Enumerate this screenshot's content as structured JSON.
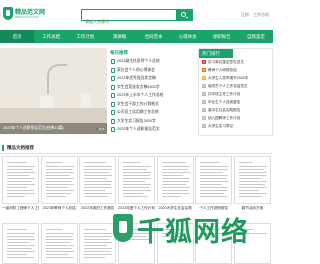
{
  "header": {
    "logo_name": "精品范文网",
    "logo_url": "www.mxzx.com",
    "search_placeholder": "请输入关键词",
    "links": [
      "注册",
      "工作总结"
    ]
  },
  "nav": {
    "items": [
      "首页",
      "工作总结",
      "工作计划",
      "演讲稿",
      "合同范本",
      "心得体会",
      "述职报告",
      "自我鉴定"
    ],
    "active_index": 0
  },
  "banner": {
    "caption": "2024年个人述职报告范文(经典10篇)"
  },
  "daily": {
    "title": "每日推荐",
    "items": [
      "2023副主任医师个人总结",
      "家长会个人的心得体会",
      "2023年优秀党员发言稿",
      "学生会竞选发言稿1500字",
      "2023年上半年个人工作总结",
      "学生会干部工作计划格式",
      "公司员工试用期工作总结",
      "大学生实习报告3000字",
      "2023年个人述职报告范文"
    ]
  },
  "hot": {
    "title": "热门排行",
    "items": [
      "实习单位鉴定意见范文",
      "教师个人研修总结",
      "大学生入党申请书2000字",
      "保安员个人工作总结范文",
      "初中班主任工作计划",
      "毕业生个人自我鉴定",
      "高中生社会实践报告",
      "幼儿园教师工作计划",
      "大学生实习周记",
      "大学生当兵申请书"
    ]
  },
  "section2": {
    "title": "精品文档推荐",
    "docs": [
      "一级消防工程师个人工作",
      "2023年教师个人总结",
      "2022年政府工作报告",
      "2023年度个人工作计划",
      "2020大学生社会实践",
      "个人工作述职报告",
      "春节活动方案"
    ]
  },
  "watermark": {
    "text": "千狐网络"
  },
  "colors": {
    "accent": "#1aa36a",
    "nav_active": "#128a59",
    "rank1": "#e23b3b",
    "rank2": "#f07a2a",
    "rank3": "#f5b52f"
  }
}
